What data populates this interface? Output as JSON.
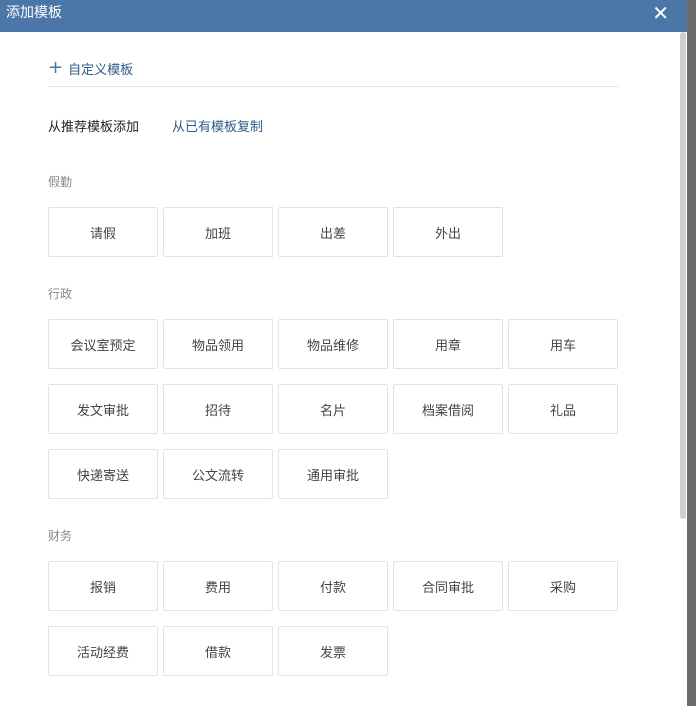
{
  "header": {
    "title": "添加模板",
    "close_icon": "close-icon"
  },
  "custom_template": {
    "label": "自定义模板"
  },
  "tabs": [
    {
      "label": "从推荐模板添加",
      "active": true
    },
    {
      "label": "从已有模板复制",
      "active": false
    }
  ],
  "sections": [
    {
      "label": "假勤",
      "items": [
        "请假",
        "加班",
        "出差",
        "外出"
      ]
    },
    {
      "label": "行政",
      "items": [
        "会议室预定",
        "物品领用",
        "物品维修",
        "用章",
        "用车",
        "发文审批",
        "招待",
        "名片",
        "档案借阅",
        "礼品",
        "快递寄送",
        "公文流转",
        "通用审批"
      ]
    },
    {
      "label": "财务",
      "items": [
        "报销",
        "费用",
        "付款",
        "合同审批",
        "采购",
        "活动经费",
        "借款",
        "发票"
      ]
    }
  ]
}
